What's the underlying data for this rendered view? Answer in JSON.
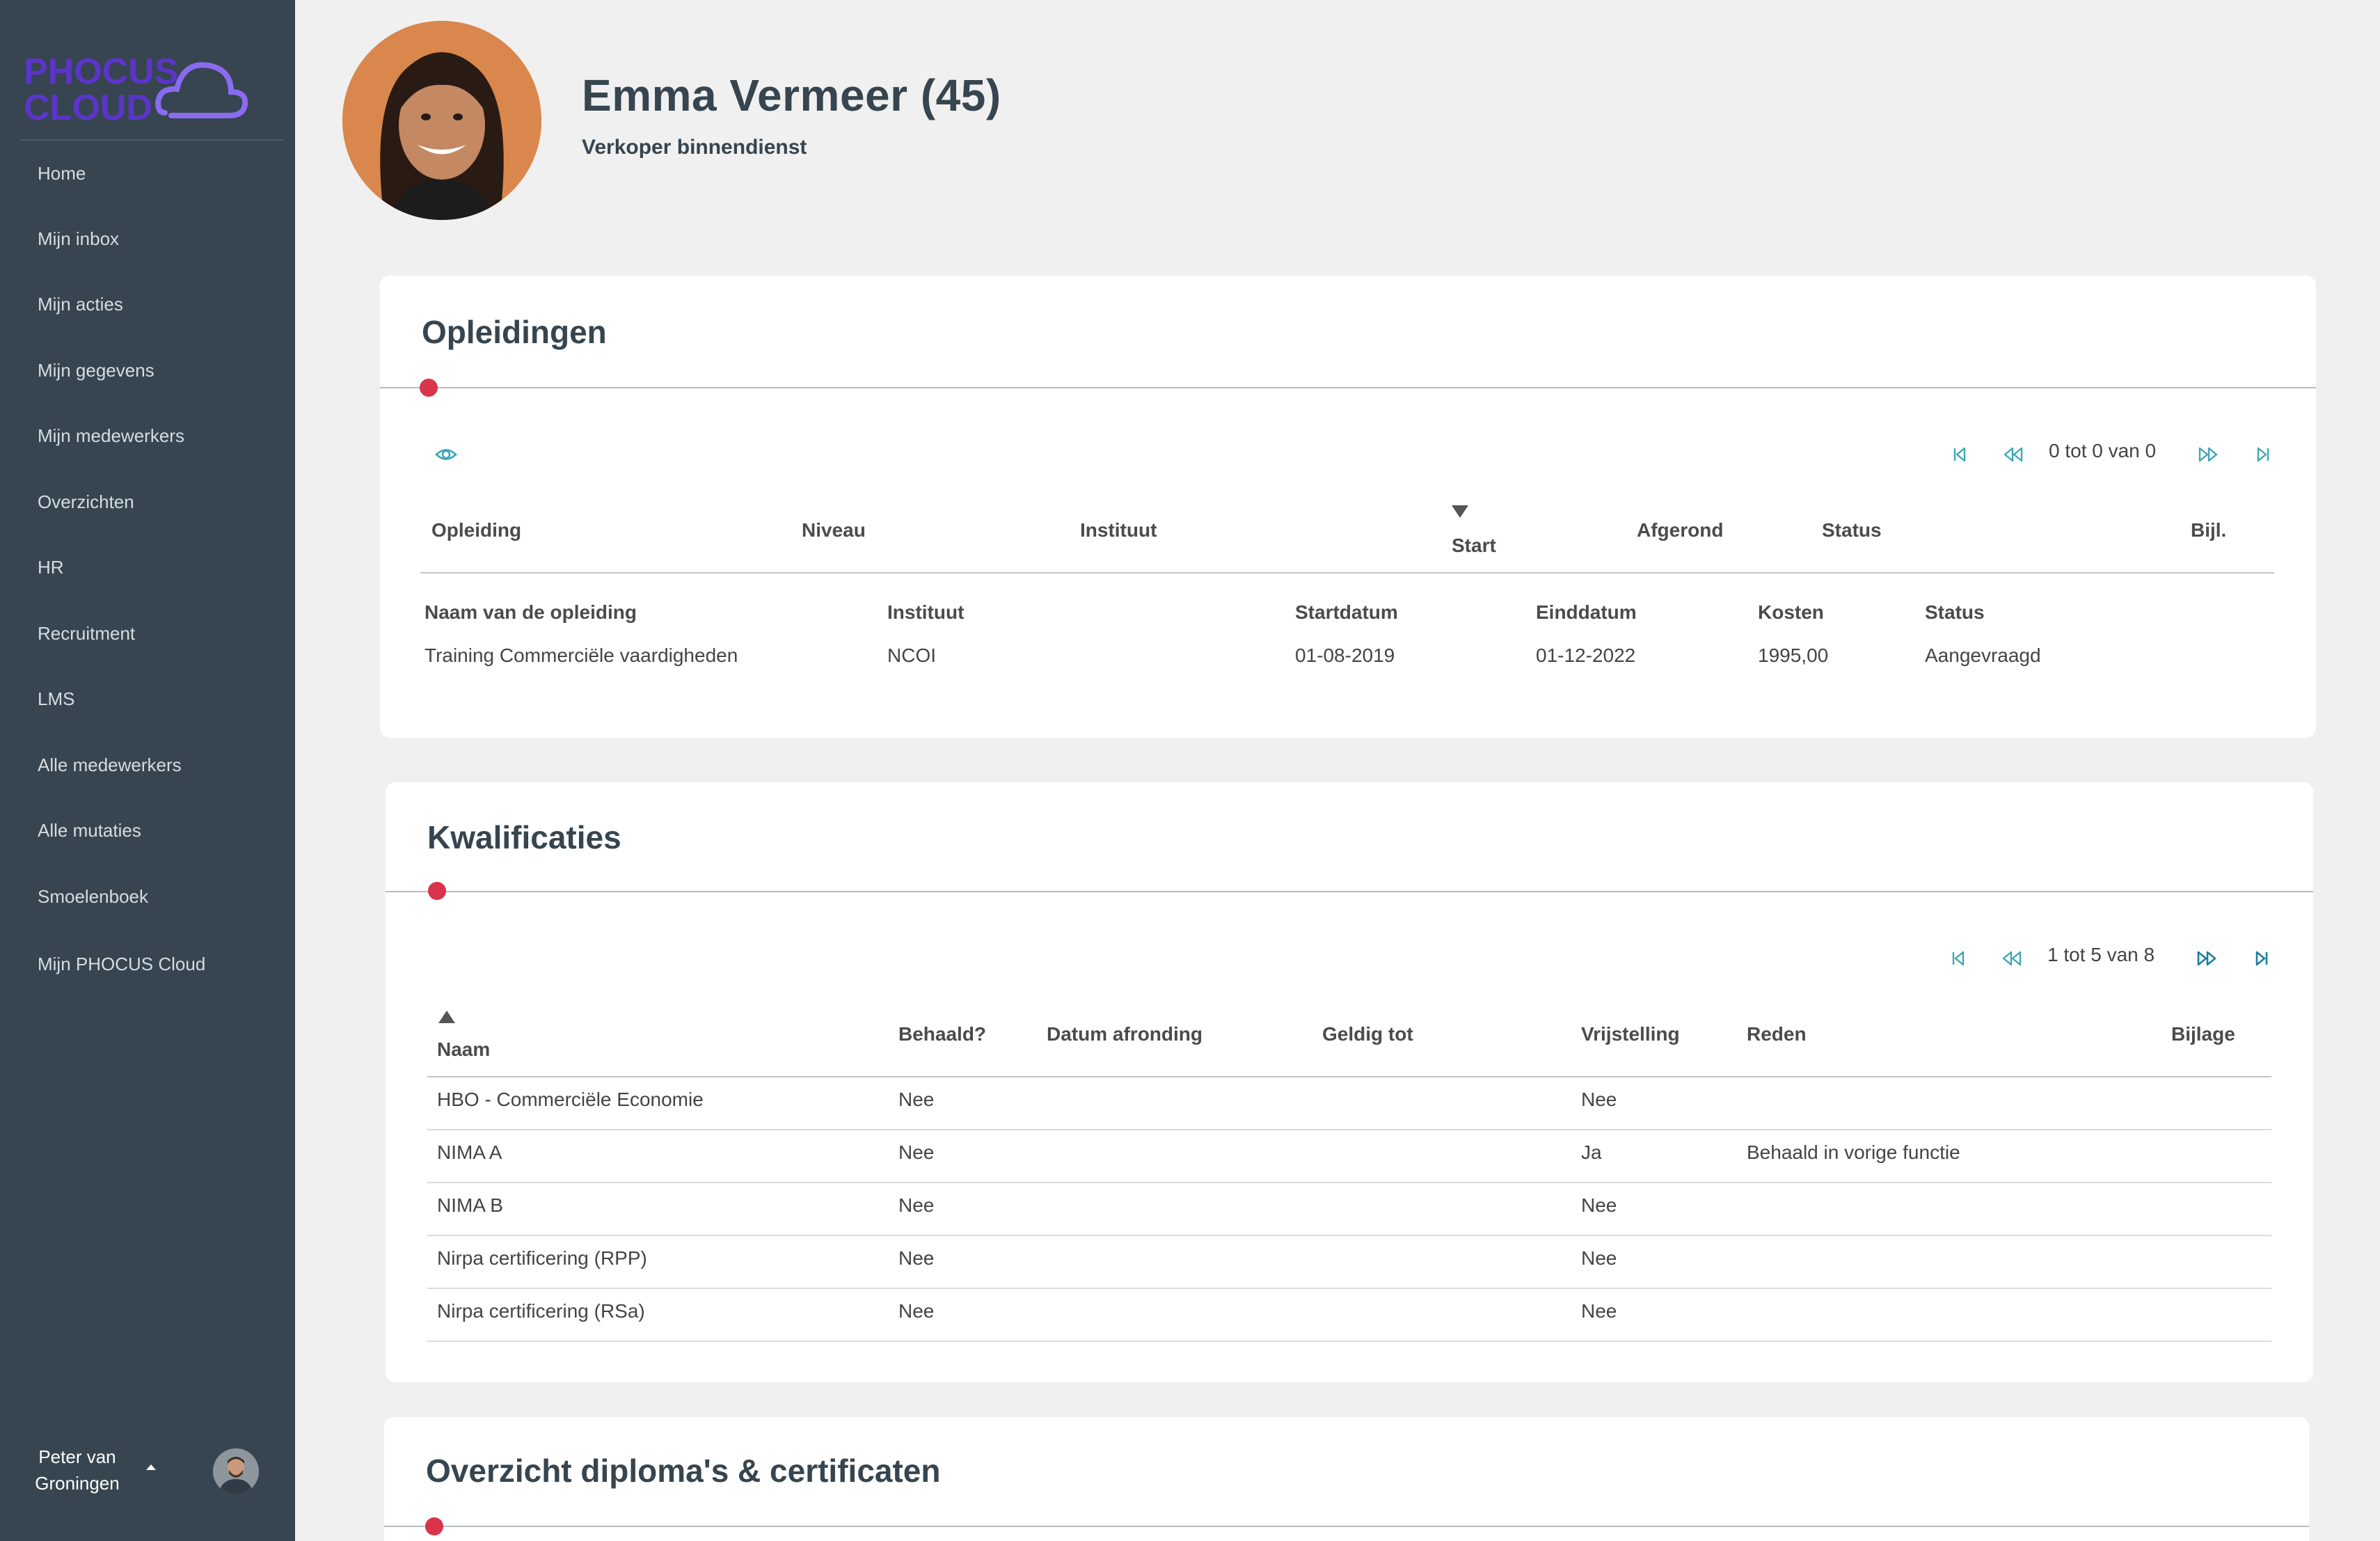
{
  "brand": {
    "line1": "PHOCUS",
    "line2": "CLOUD",
    "color": "#5b35c9"
  },
  "sidebar": {
    "items": [
      {
        "label": "Home"
      },
      {
        "label": "Mijn inbox"
      },
      {
        "label": "Mijn acties"
      },
      {
        "label": "Mijn gegevens"
      },
      {
        "label": "Mijn medewerkers"
      },
      {
        "label": "Overzichten"
      },
      {
        "label": "HR"
      },
      {
        "label": "Recruitment"
      },
      {
        "label": "LMS"
      },
      {
        "label": "Alle medewerkers"
      },
      {
        "label": "Alle mutaties"
      },
      {
        "label": "Smoelenboek"
      },
      {
        "label": "Mijn PHOCUS Cloud"
      }
    ],
    "user": {
      "line1": "Peter van",
      "line2": "Groningen"
    }
  },
  "profile": {
    "name": "Emma Vermeer (45)",
    "role": "Verkoper binnendienst"
  },
  "opleidingen": {
    "title": "Opleidingen",
    "pager": "0 tot 0 van 0",
    "columns": [
      "Opleiding",
      "Niveau",
      "Instituut",
      "Start",
      "Afgerond",
      "Status",
      "Bijl."
    ],
    "detail_headers": [
      "Naam van de opleiding",
      "Instituut",
      "Startdatum",
      "Einddatum",
      "Kosten",
      "Status"
    ],
    "detail_values": [
      "Training Commerciële vaardigheden",
      "NCOI",
      "01-08-2019",
      "01-12-2022",
      "1995,00",
      "Aangevraagd"
    ]
  },
  "kwalificaties": {
    "title": "Kwalificaties",
    "pager": "1 tot 5 van 8",
    "columns": [
      "Naam",
      "Behaald?",
      "Datum afronding",
      "Geldig tot",
      "Vrijstelling",
      "Reden",
      "Bijlage"
    ],
    "rows": [
      {
        "naam": "HBO - Commerciële Economie",
        "behaald": "Nee",
        "vrijstelling": "Nee",
        "reden": ""
      },
      {
        "naam": "NIMA A",
        "behaald": "Nee",
        "vrijstelling": "Ja",
        "reden": "Behaald in vorige functie"
      },
      {
        "naam": "NIMA B",
        "behaald": "Nee",
        "vrijstelling": "Nee",
        "reden": ""
      },
      {
        "naam": "Nirpa certificering (RPP)",
        "behaald": "Nee",
        "vrijstelling": "Nee",
        "reden": ""
      },
      {
        "naam": "Nirpa certificering (RSa)",
        "behaald": "Nee",
        "vrijstelling": "Nee",
        "reden": ""
      }
    ]
  },
  "diplomas": {
    "title": "Overzicht diploma's & certificaten"
  },
  "colors": {
    "sidebar": "#36454f",
    "accent_dot": "#d8344b",
    "pager_icon": "#3fa6b8",
    "heading": "#36454f"
  }
}
